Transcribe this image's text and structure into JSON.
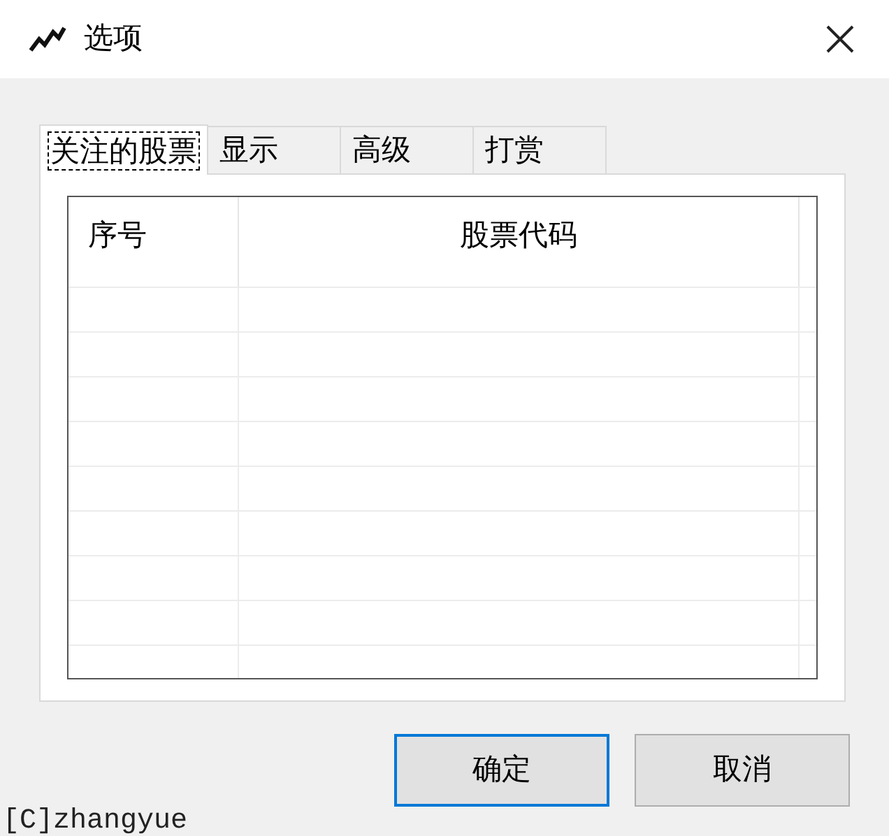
{
  "window": {
    "title": "选项"
  },
  "tabs": [
    {
      "label": "关注的股票",
      "selected": true
    },
    {
      "label": "显示",
      "selected": false
    },
    {
      "label": "高级",
      "selected": false
    },
    {
      "label": "打赏",
      "selected": false
    }
  ],
  "table": {
    "columns": [
      "序号",
      "股票代码"
    ]
  },
  "buttons": [
    {
      "label": "确定",
      "default": true
    },
    {
      "label": "取消",
      "default": false
    }
  ],
  "footer": "[C]zhangyue"
}
